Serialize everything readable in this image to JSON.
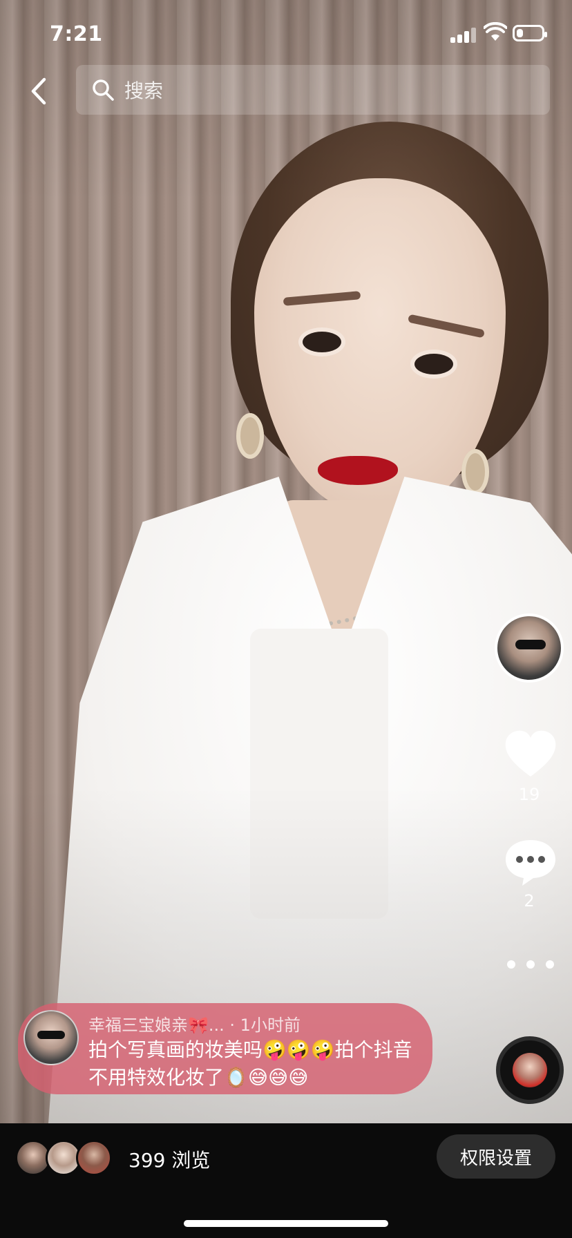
{
  "status_bar": {
    "time": "7:21",
    "battery_level": 0.25
  },
  "header": {
    "search_placeholder": "搜索"
  },
  "actions": {
    "likes": "19",
    "comments": "2"
  },
  "comment_bubble": {
    "author": "幸福三宝娘亲🎀...",
    "time": "· 1小时前",
    "text": "拍个写真画的妆美吗🤪🤪🤪拍个抖音不用特效化妆了🪞😅😅😅"
  },
  "bottom_bar": {
    "views": "399 浏览",
    "permissions_button": "权限设置"
  }
}
